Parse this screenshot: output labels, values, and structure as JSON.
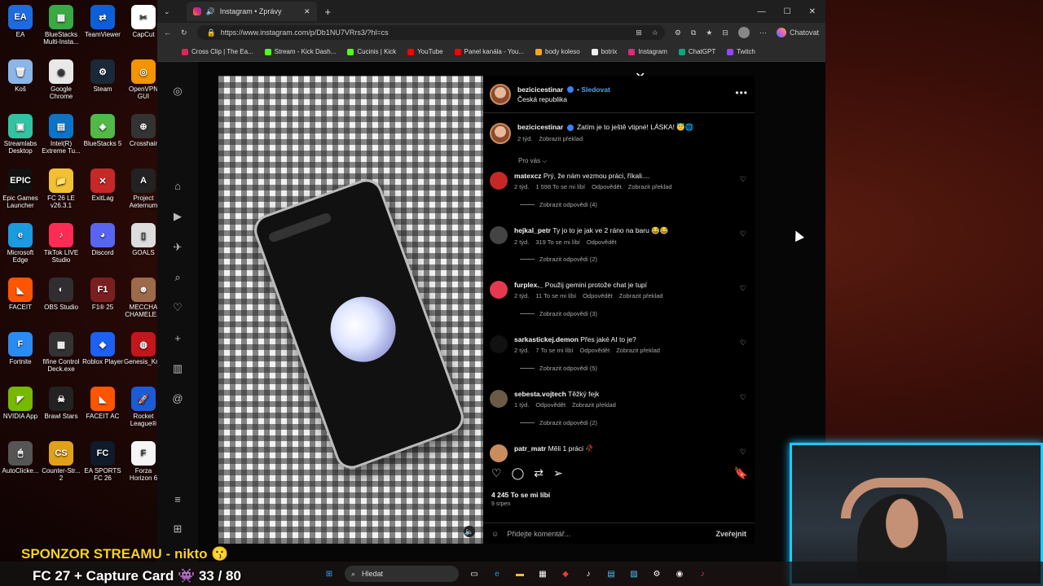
{
  "desktop": {
    "icons": [
      {
        "label": "EA",
        "color": "#1e6be0",
        "glyph": "EA"
      },
      {
        "label": "BlueStacks Multi-Insta...",
        "color": "#3aa843",
        "glyph": "▦"
      },
      {
        "label": "TeamViewer",
        "color": "#0d5fd7",
        "glyph": "⇄"
      },
      {
        "label": "CapCut",
        "color": "#fff",
        "glyph": "✂"
      },
      {
        "label": "Koš",
        "color": "#8bb6e8",
        "glyph": "🗑"
      },
      {
        "label": "Google Chrome",
        "color": "#e8e8e8",
        "glyph": "◉"
      },
      {
        "label": "Steam",
        "color": "#1b2838",
        "glyph": "⚙"
      },
      {
        "label": "OpenVPN GUI",
        "color": "#f29500",
        "glyph": "◎"
      },
      {
        "label": "Streamlabs Desktop",
        "color": "#31c3a2",
        "glyph": "▣"
      },
      {
        "label": "Intel(R) Extreme Tu...",
        "color": "#0b74c7",
        "glyph": "▤"
      },
      {
        "label": "BlueStacks 5",
        "color": "#52b848",
        "glyph": "◈"
      },
      {
        "label": "Crosshair",
        "color": "#333",
        "glyph": "⊕"
      },
      {
        "label": "Epic Games Launcher",
        "color": "#111",
        "glyph": "EPIC"
      },
      {
        "label": "FC 26 LE v26.3.1",
        "color": "#f2c033",
        "glyph": "📁"
      },
      {
        "label": "ExitLag",
        "color": "#c62828",
        "glyph": "✕"
      },
      {
        "label": "Project Aeternum",
        "color": "#222",
        "glyph": "A"
      },
      {
        "label": "Microsoft Edge",
        "color": "#1b9ae0",
        "glyph": "e"
      },
      {
        "label": "TikTok LIVE Studio",
        "color": "#fe2c55",
        "glyph": "♪"
      },
      {
        "label": "Discord",
        "color": "#5865f2",
        "glyph": "◕"
      },
      {
        "label": "GOALS",
        "color": "#ddd",
        "glyph": "▯"
      },
      {
        "label": "FACEIT",
        "color": "#ff5500",
        "glyph": "◣"
      },
      {
        "label": "OBS Studio",
        "color": "#302e31",
        "glyph": "◐"
      },
      {
        "label": "F1® 25",
        "color": "#7a1f1f",
        "glyph": "F1"
      },
      {
        "label": "MECCHA CHAMELE...",
        "color": "#9d6b4a",
        "glyph": "☻"
      },
      {
        "label": "Fortnite",
        "color": "#2a8cf2",
        "glyph": "F"
      },
      {
        "label": "fifine Control Deck.exe",
        "color": "#333",
        "glyph": "▦"
      },
      {
        "label": "Roblox Player",
        "color": "#1d60f2",
        "glyph": "◆"
      },
      {
        "label": "Genesis_Kr...",
        "color": "#c4161c",
        "glyph": "◍"
      },
      {
        "label": "NVIDIA App",
        "color": "#76b900",
        "glyph": "◤"
      },
      {
        "label": "Brawl Stars",
        "color": "#222",
        "glyph": "☠"
      },
      {
        "label": "FACEIT AC",
        "color": "#ff5500",
        "glyph": "◣"
      },
      {
        "label": "Rocket League®",
        "color": "#1a5bd6",
        "glyph": "🚀"
      },
      {
        "label": "AutoClicke...",
        "color": "#555",
        "glyph": "🖱"
      },
      {
        "label": "Counter-Str... 2",
        "color": "#e0a01a",
        "glyph": "CS"
      },
      {
        "label": "EA SPORTS FC 26",
        "color": "#0f1a2a",
        "glyph": "FC"
      },
      {
        "label": "Forza Horizon 6",
        "color": "#f5f5f5",
        "glyph": "F"
      }
    ]
  },
  "browser": {
    "tab_title": "Instagram • Zprávy",
    "url": "https://www.instagram.com/p/Db1NU7VRrs3/?hl=cs",
    "copilot_label": "Chatovat",
    "favorites": [
      "Cross Clip | The Ea...",
      "Stream - Kick Dash...",
      "Cucinis | Kick",
      "YouTube",
      "Panel kanála - You...",
      "body koleso",
      "botrix",
      "Instagram",
      "ChatGPT",
      "Twitch"
    ],
    "favorite_colors": [
      "#e0245e",
      "#53fc18",
      "#53fc18",
      "#ff0000",
      "#ff0000",
      "#f5a623",
      "#eee",
      "#dd2a7b",
      "#10a37f",
      "#9146ff"
    ]
  },
  "post": {
    "author": "bezicicestinar",
    "follow_label": "Sledovat",
    "location": "Česká republika",
    "caption": "Zatím je to ještě vtipné! LÁSKA! 😇🌐",
    "caption_time": "2 týd.",
    "translate_label": "Zobrazit překlad",
    "for_you_label": "Pro vás ⌵",
    "likes": "4 245 To se mi líbí",
    "date": "9 srpen",
    "comment_placeholder": "Přidejte komentář...",
    "post_label": "Zveřejnit"
  },
  "comments": [
    {
      "user": "matexcz",
      "text": "Prý, že nám vezmou práci, říkali....",
      "time": "2 týd.",
      "likes": "1 598 To se mi líbí",
      "reply": "Odpovědět",
      "translate": "Zobrazit překlad",
      "replies": "Zobrazit odpovědi (4)",
      "avatar": "#c62828"
    },
    {
      "user": "hejkal_petr",
      "text": "Ty jo to je jak ve 2 ráno na baru 😂😂",
      "time": "2 týd.",
      "likes": "319 To se mi líbí",
      "reply": "Odpovědět",
      "translate": "",
      "replies": "Zobrazit odpovědi (2)",
      "avatar": "#444"
    },
    {
      "user": "furplex._",
      "text": "Použij gemini protože chat je tupí",
      "time": "2 týd.",
      "likes": "11 To se mi líbí",
      "reply": "Odpovědět",
      "translate": "Zobrazit překlad",
      "replies": "Zobrazit odpovědi (3)",
      "avatar": "#e53950"
    },
    {
      "user": "sarkastickej.demon",
      "text": "Přes jaké AI to je?",
      "time": "2 týd.",
      "likes": "7 To se mi líbí",
      "reply": "Odpovědět",
      "translate": "Zobrazit překlad",
      "replies": "Zobrazit odpovědi (5)",
      "avatar": "#111"
    },
    {
      "user": "sebesta.vojtech",
      "text": "Těžký fejk",
      "time": "1 týd.",
      "likes": "",
      "reply": "Odpovědět",
      "translate": "Zobrazit překlad",
      "replies": "Zobrazit odpovědi (2)",
      "avatar": "#6b5a45"
    },
    {
      "user": "patr_matr",
      "text": "Měli 1 práci 🥀",
      "time": "",
      "likes": "",
      "reply": "",
      "translate": "",
      "replies": "",
      "avatar": "#c98d5d"
    }
  ],
  "overlay_text": {
    "sponsor": "SPONZOR STREAMU - nikto 😗",
    "fc_bar": "FC 27 + Capture Card 👾 33 / 80"
  },
  "taskbar": {
    "search": "Hledat"
  }
}
